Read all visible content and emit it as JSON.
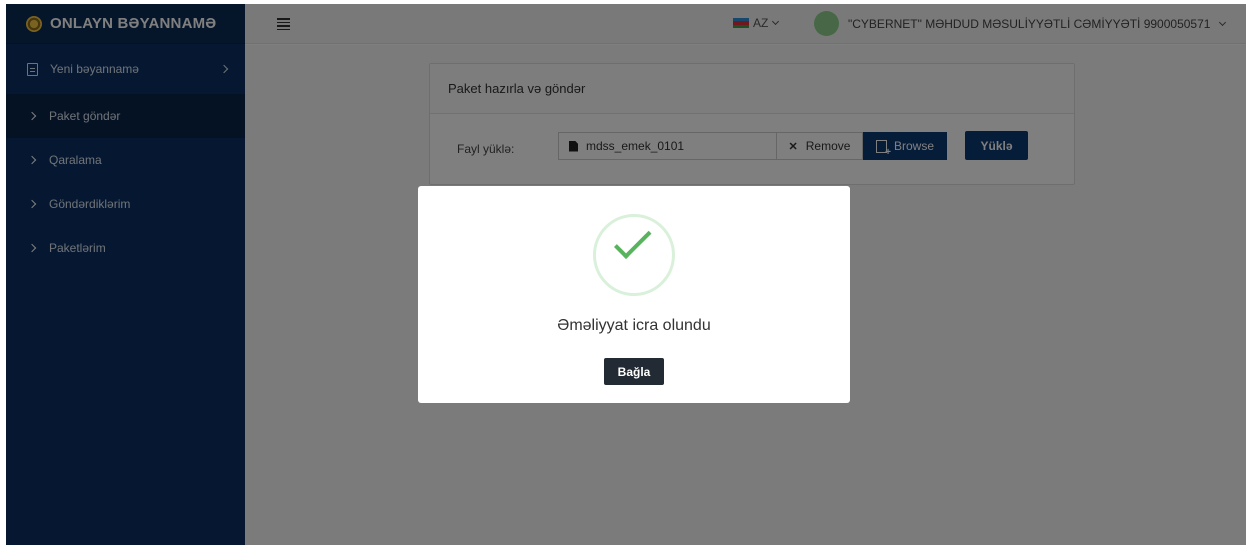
{
  "brand": {
    "title": "ONLAYN BƏYANNAMƏ",
    "logo_icon": "emblem-icon"
  },
  "sidebar": {
    "items": [
      {
        "label": "Yeni bəyannamə",
        "icon": "document-icon"
      },
      {
        "label": "Paket göndər",
        "icon": "chevron-right-icon"
      },
      {
        "label": "Qaralama",
        "icon": "chevron-right-icon"
      },
      {
        "label": "Göndərdiklərim",
        "icon": "chevron-right-icon"
      },
      {
        "label": "Paketlərim",
        "icon": "chevron-right-icon"
      }
    ]
  },
  "topbar": {
    "language": "AZ",
    "user_name": "\"CYBERNET\" MƏHDUD MƏSULİYYƏTLİ CƏMİYYƏTİ 9900050571"
  },
  "panel": {
    "title": "Paket hazırla və göndər",
    "file_label": "Fayl yüklə:",
    "file_name": "mdss_emek_0101",
    "remove_label": "Remove",
    "browse_label": "Browse",
    "upload_label": "Yüklə"
  },
  "modal": {
    "message": "Əməliyyat icra olundu",
    "close_label": "Bağla"
  },
  "colors": {
    "sidebar": "#0d3162",
    "primary_button": "#0d3b75",
    "success": "#58b45c"
  }
}
